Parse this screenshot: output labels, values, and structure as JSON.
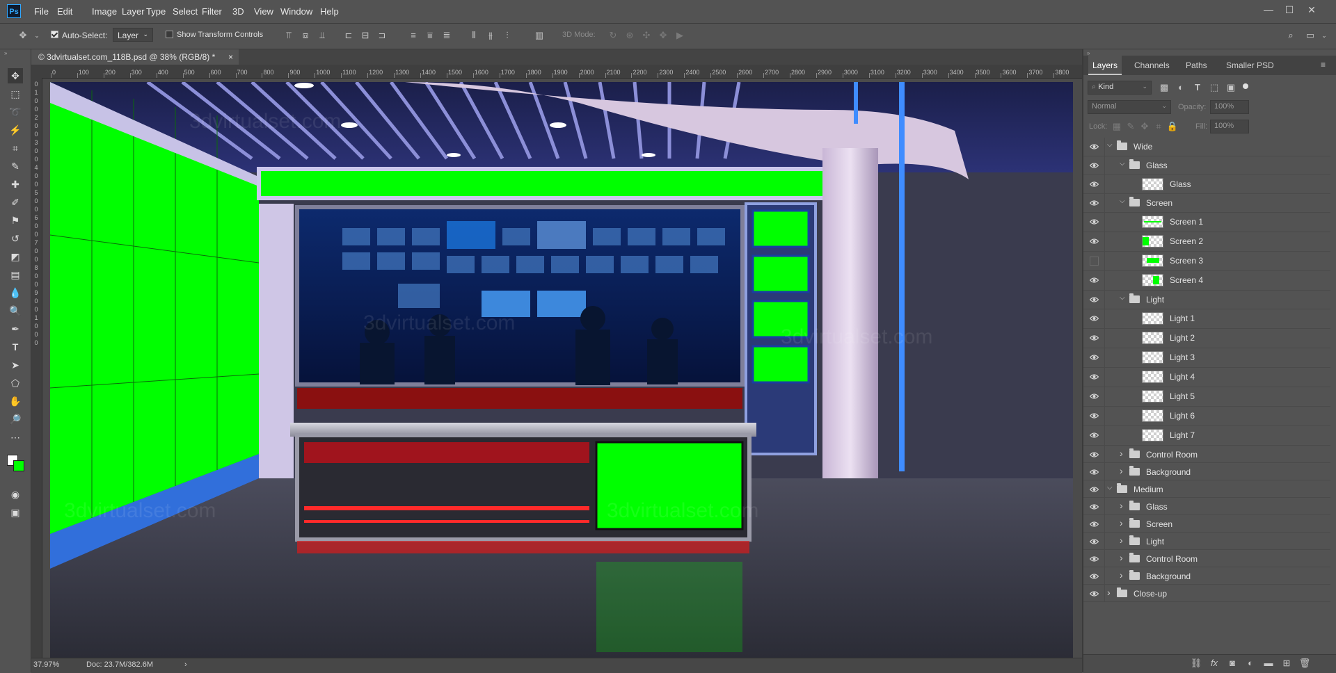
{
  "app": {
    "logo": "Ps"
  },
  "menu": [
    "File",
    "Edit",
    "Image",
    "Layer",
    "Type",
    "Select",
    "Filter",
    "3D",
    "View",
    "Window",
    "Help"
  ],
  "options": {
    "auto_select_label": "Auto-Select:",
    "auto_select_checked": true,
    "layer_dropdown": "Layer",
    "transform_label": "Show Transform Controls",
    "transform_checked": false,
    "mode_3d_label": "3D Mode:"
  },
  "document": {
    "tab_title": "© 3dvirtualset.com_118B.psd @ 38% (RGB/8) *",
    "close": "×"
  },
  "ruler": {
    "top_ticks": [
      "0",
      "100",
      "200",
      "300",
      "400",
      "500",
      "600",
      "700",
      "800",
      "900",
      "1000",
      "1100",
      "1200",
      "1300",
      "1400",
      "1500",
      "1600",
      "1700",
      "1800",
      "1900",
      "2000",
      "2100",
      "2200",
      "2300",
      "2400",
      "2500",
      "2600",
      "2700",
      "2800",
      "2900",
      "3000",
      "3100",
      "3200",
      "3300",
      "3400",
      "3500",
      "3600",
      "3700",
      "3800"
    ],
    "left_ticks": [
      "0",
      "1",
      "0",
      "0",
      "2",
      "0",
      "0",
      "3",
      "0",
      "0",
      "4",
      "0",
      "0",
      "5",
      "0",
      "0",
      "6",
      "0",
      "0",
      "7",
      "0",
      "0",
      "8",
      "0",
      "0",
      "9",
      "0",
      "0",
      "1",
      "0",
      "0",
      "0"
    ]
  },
  "status": {
    "zoom": "37.97%",
    "doc": "Doc: 23.7M/382.6M",
    "arrow": "›"
  },
  "panel": {
    "tabs": [
      "Layers",
      "Channels",
      "Paths",
      "Smaller PSD"
    ],
    "active_tab": "Layers",
    "filter_kind": "Kind",
    "blend_mode": "Normal",
    "opacity_label": "Opacity:",
    "opacity_value": "100%",
    "lock_label": "Lock:",
    "fill_label": "Fill:",
    "fill_value": "100%"
  },
  "layers": [
    {
      "name": "Wide",
      "type": "group",
      "indent": 0,
      "expanded": true,
      "visible": true
    },
    {
      "name": "Glass",
      "type": "group",
      "indent": 1,
      "expanded": true,
      "visible": true
    },
    {
      "name": "Glass",
      "type": "layer",
      "indent": 2,
      "visible": true,
      "thumb": "transparent"
    },
    {
      "name": "Screen",
      "type": "group",
      "indent": 1,
      "expanded": true,
      "visible": true
    },
    {
      "name": "Screen 1",
      "type": "layer",
      "indent": 2,
      "visible": true,
      "thumb": "green-line"
    },
    {
      "name": "Screen 2",
      "type": "layer",
      "indent": 2,
      "visible": true,
      "thumb": "green-left"
    },
    {
      "name": "Screen 3",
      "type": "layer",
      "indent": 2,
      "visible": false,
      "thumb": "green-bar"
    },
    {
      "name": "Screen 4",
      "type": "layer",
      "indent": 2,
      "visible": true,
      "thumb": "green-right"
    },
    {
      "name": "Light",
      "type": "group",
      "indent": 1,
      "expanded": true,
      "visible": true
    },
    {
      "name": "Light 1",
      "type": "layer",
      "indent": 2,
      "visible": true,
      "thumb": "transparent"
    },
    {
      "name": "Light 2",
      "type": "layer",
      "indent": 2,
      "visible": true,
      "thumb": "transparent"
    },
    {
      "name": "Light 3",
      "type": "layer",
      "indent": 2,
      "visible": true,
      "thumb": "transparent"
    },
    {
      "name": "Light 4",
      "type": "layer",
      "indent": 2,
      "visible": true,
      "thumb": "transparent"
    },
    {
      "name": "Light 5",
      "type": "layer",
      "indent": 2,
      "visible": true,
      "thumb": "transparent"
    },
    {
      "name": "Light 6",
      "type": "layer",
      "indent": 2,
      "visible": true,
      "thumb": "transparent"
    },
    {
      "name": "Light 7",
      "type": "layer",
      "indent": 2,
      "visible": true,
      "thumb": "transparent"
    },
    {
      "name": "Control Room",
      "type": "group",
      "indent": 1,
      "expanded": false,
      "visible": true
    },
    {
      "name": "Background",
      "type": "group",
      "indent": 1,
      "expanded": false,
      "visible": true
    },
    {
      "name": "Medium",
      "type": "group",
      "indent": 0,
      "expanded": true,
      "visible": true
    },
    {
      "name": "Glass",
      "type": "group",
      "indent": 1,
      "expanded": false,
      "visible": true
    },
    {
      "name": "Screen",
      "type": "group",
      "indent": 1,
      "expanded": false,
      "visible": true
    },
    {
      "name": "Light",
      "type": "group",
      "indent": 1,
      "expanded": false,
      "visible": true
    },
    {
      "name": "Control Room",
      "type": "group",
      "indent": 1,
      "expanded": false,
      "visible": true
    },
    {
      "name": "Background",
      "type": "group",
      "indent": 1,
      "expanded": false,
      "visible": true
    },
    {
      "name": "Close-up",
      "type": "group",
      "indent": 0,
      "expanded": false,
      "visible": true
    }
  ],
  "watermark": "3dvirtualset.com",
  "colors": {
    "chroma_green": "#00ff00",
    "accent_blue": "#31a8ff",
    "panel_bg": "#535353"
  }
}
